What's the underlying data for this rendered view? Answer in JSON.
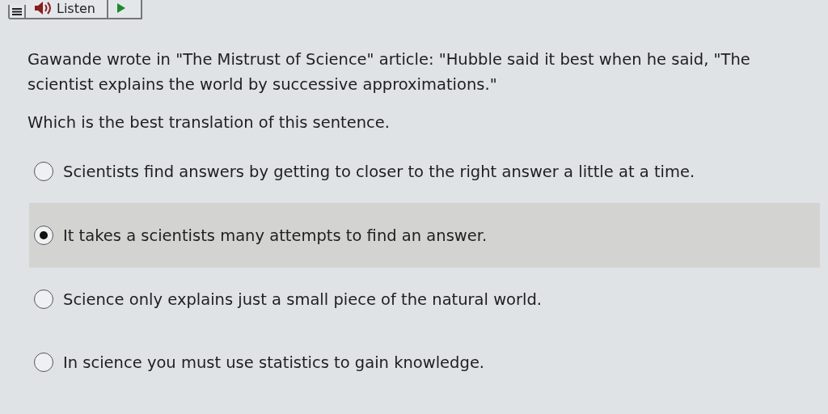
{
  "toolbar": {
    "listen_label": "Listen"
  },
  "question": {
    "quote": "Gawande wrote in \"The Mistrust of Science\" article: \"Hubble said it best when he said, \"The scientist explains the world by successive approximations.\"",
    "prompt": "Which is the best translation of this sentence."
  },
  "options": [
    {
      "label": "Scientists find answers by getting to closer to the right answer a little at a time.",
      "selected": false
    },
    {
      "label": "It takes a scientists many attempts to find an answer.",
      "selected": true
    },
    {
      "label": "Science only explains just a small piece of the natural world.",
      "selected": false
    },
    {
      "label": "In science you must use statistics to gain knowledge.",
      "selected": false
    }
  ]
}
